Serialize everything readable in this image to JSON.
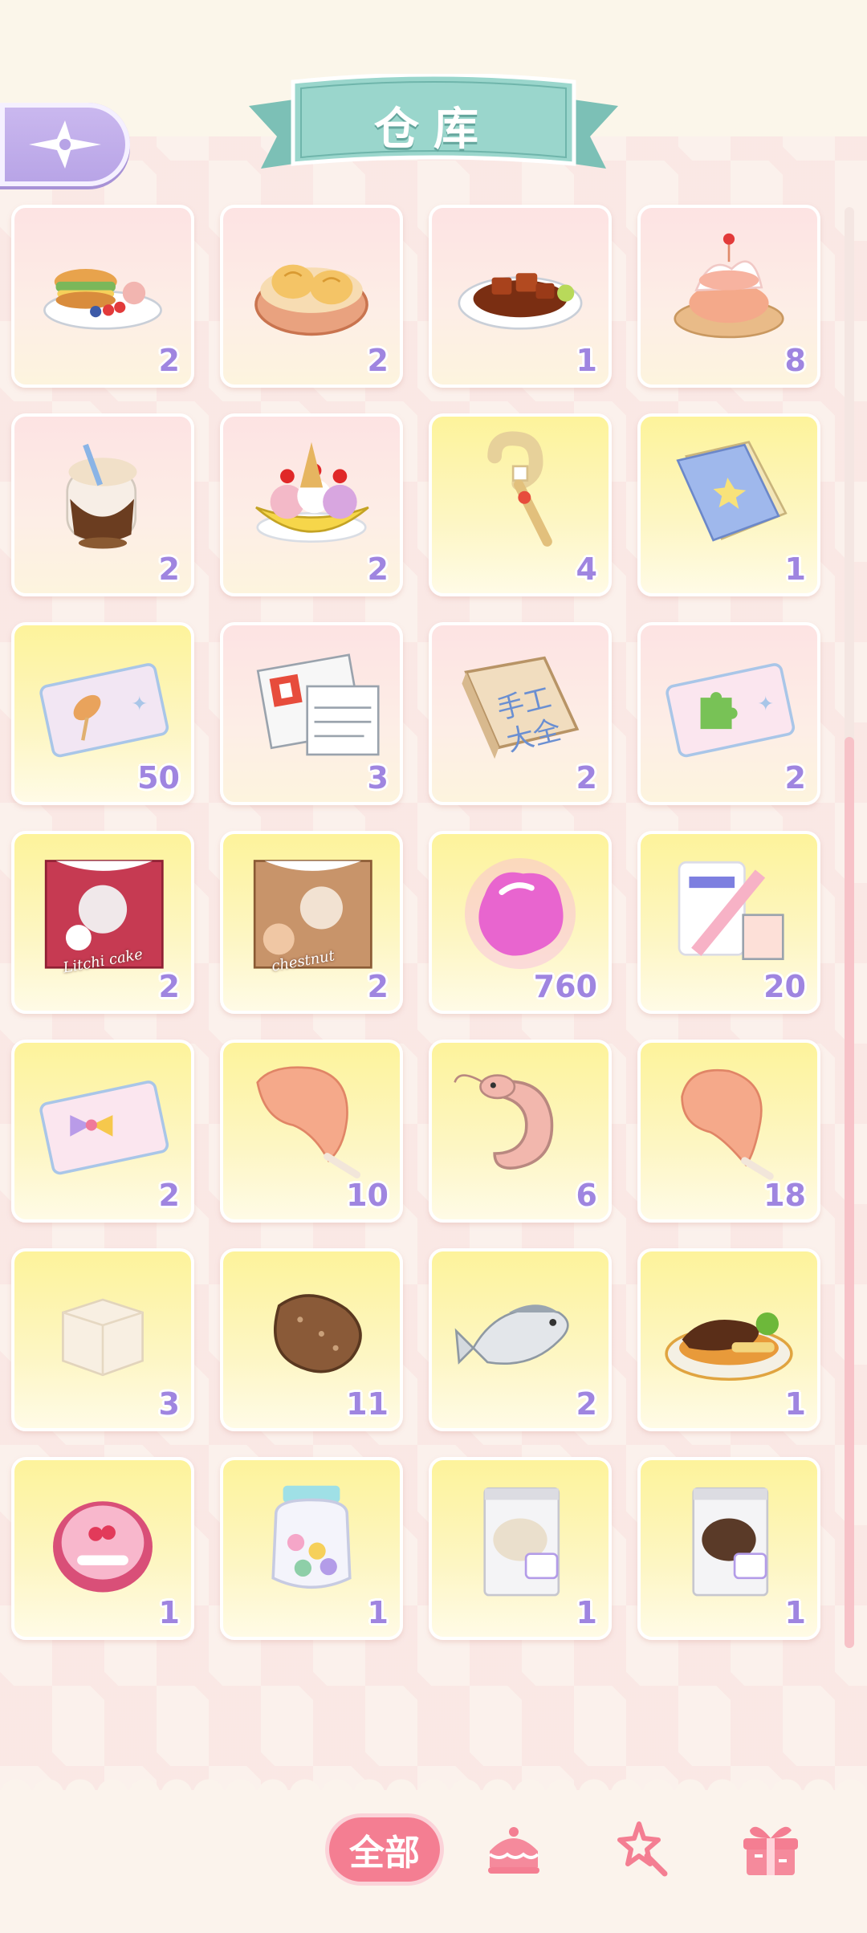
{
  "header": {
    "title": "仓库",
    "back_icon": "four-point-star-arrow-icon"
  },
  "items": [
    {
      "name": "burger-platter",
      "count": "2",
      "bg": "pink"
    },
    {
      "name": "steamed-buns",
      "count": "2",
      "bg": "pink"
    },
    {
      "name": "braised-pork",
      "count": "1",
      "bg": "pink"
    },
    {
      "name": "cream-puff",
      "count": "8",
      "bg": "pink"
    },
    {
      "name": "iced-coffee",
      "count": "2",
      "bg": "pink"
    },
    {
      "name": "banana-split",
      "count": "2",
      "bg": "pink"
    },
    {
      "name": "magic-wand",
      "count": "4",
      "bg": "yellow"
    },
    {
      "name": "blue-book",
      "count": "1",
      "bg": "yellow"
    },
    {
      "name": "snack-ticket",
      "count": "50",
      "bg": "yellow"
    },
    {
      "name": "newspapers",
      "count": "3",
      "bg": "pink"
    },
    {
      "name": "craft-manual",
      "count": "2",
      "bg": "pink",
      "book_text": [
        "手工",
        "大全"
      ]
    },
    {
      "name": "puzzle-ticket",
      "count": "2",
      "bg": "pink"
    },
    {
      "name": "lychee-cake-stickers",
      "count": "2",
      "bg": "yellow",
      "label": "Litchi cake"
    },
    {
      "name": "chestnut-stickers",
      "count": "2",
      "bg": "yellow",
      "label": "chestnut"
    },
    {
      "name": "pink-gem",
      "count": "760",
      "bg": "yellow"
    },
    {
      "name": "photo-cards",
      "count": "20",
      "bg": "yellow"
    },
    {
      "name": "bow-ticket",
      "count": "2",
      "bg": "yellow"
    },
    {
      "name": "chicken-leg",
      "count": "10",
      "bg": "yellow"
    },
    {
      "name": "shrimp",
      "count": "6",
      "bg": "yellow"
    },
    {
      "name": "turkey-leg",
      "count": "18",
      "bg": "yellow"
    },
    {
      "name": "tofu",
      "count": "3",
      "bg": "yellow"
    },
    {
      "name": "sea-cucumber",
      "count": "11",
      "bg": "yellow"
    },
    {
      "name": "fish",
      "count": "2",
      "bg": "yellow"
    },
    {
      "name": "steak-dish",
      "count": "1",
      "bg": "yellow"
    },
    {
      "name": "badge",
      "count": "1",
      "bg": "yellow"
    },
    {
      "name": "candy-jar",
      "count": "1",
      "bg": "yellow"
    },
    {
      "name": "white-flour-bag",
      "count": "1",
      "bg": "yellow"
    },
    {
      "name": "cocoa-bag",
      "count": "1",
      "bg": "yellow"
    }
  ],
  "bottom_nav": {
    "all_label": "全部",
    "tabs": [
      {
        "icon": "cake-icon"
      },
      {
        "icon": "magic-wand-icon"
      },
      {
        "icon": "gift-box-icon"
      }
    ]
  },
  "colors": {
    "accent_pink": "#f47e92",
    "count_purple": "#9f85e0",
    "ribbon_teal": "#8ccfc4",
    "back_purple": "#b7a3e6"
  }
}
